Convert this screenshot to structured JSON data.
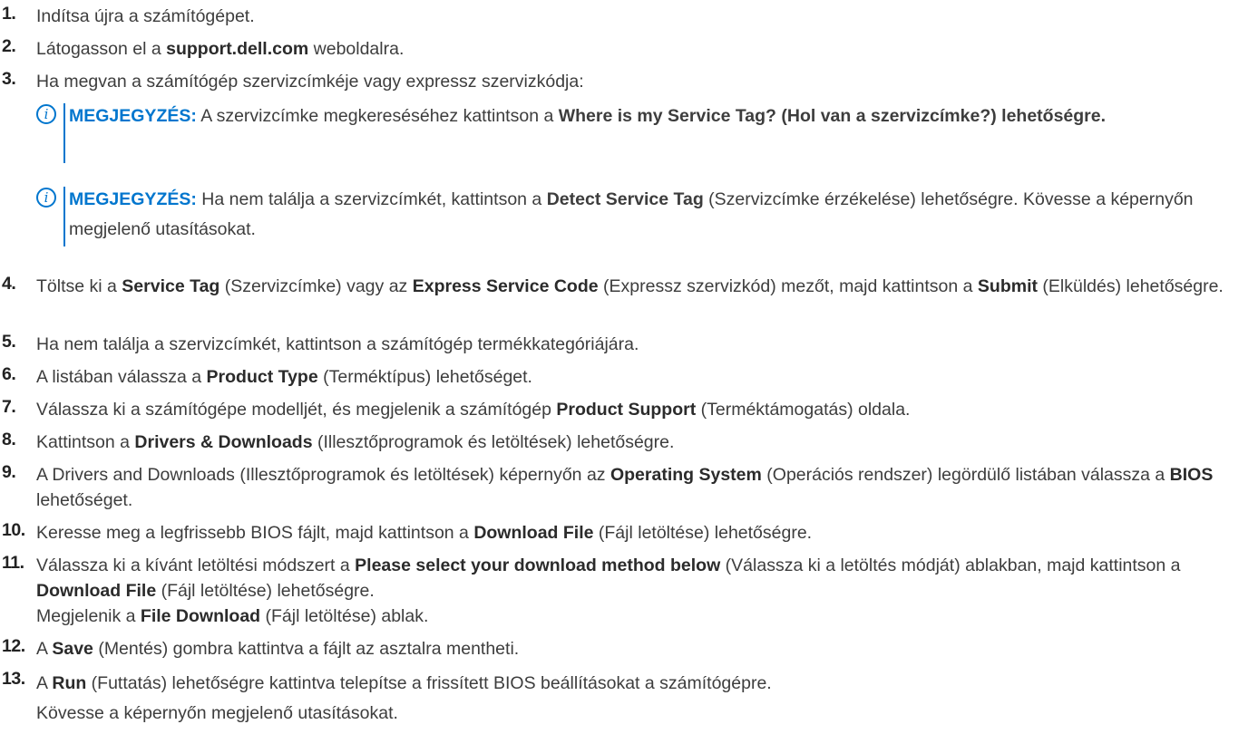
{
  "steps": [
    {
      "num": "1.",
      "text": [
        {
          "t": "Indítsa újra a számítógépet."
        }
      ]
    },
    {
      "num": "2.",
      "text": [
        {
          "t": "Látogasson el a "
        },
        {
          "t": "support.dell.com",
          "b": true
        },
        {
          "t": " weboldalra."
        }
      ]
    },
    {
      "num": "3.",
      "text": [
        {
          "t": "Ha megvan a számítógép szervizcímkéje vagy expressz szervizkódja:"
        }
      ]
    },
    {
      "num": "4.",
      "text": [
        {
          "t": "Töltse ki a "
        },
        {
          "t": "Service Tag",
          "b": true
        },
        {
          "t": " (Szervizcímke) vagy az "
        },
        {
          "t": "Express Service Code",
          "b": true
        },
        {
          "t": " (Expressz szervizkód) mezőt, majd kattintson a "
        },
        {
          "t": "Submit",
          "b": true
        },
        {
          "t": " (Elküldés) lehetőségre."
        }
      ]
    },
    {
      "num": "5.",
      "text": [
        {
          "t": "Ha nem találja a szervizcímkét, kattintson a számítógép termékkategóriájára."
        }
      ]
    },
    {
      "num": "6.",
      "text": [
        {
          "t": "A listában válassza a "
        },
        {
          "t": "Product Type",
          "b": true
        },
        {
          "t": " (Terméktípus) lehetőséget."
        }
      ]
    },
    {
      "num": "7.",
      "text": [
        {
          "t": "Válassza ki a számítógépe modelljét, és megjelenik a számítógép "
        },
        {
          "t": "Product Support",
          "b": true
        },
        {
          "t": " (Terméktámogatás) oldala."
        }
      ]
    },
    {
      "num": "8.",
      "text": [
        {
          "t": "Kattintson a "
        },
        {
          "t": "Drivers & Downloads",
          "b": true
        },
        {
          "t": " (Illesztőprogramok és letöltések) lehetőségre."
        }
      ]
    },
    {
      "num": "9.",
      "text": [
        {
          "t": "A Drivers and Downloads (Illesztőprogramok és letöltések) képernyőn az "
        },
        {
          "t": "Operating System",
          "b": true
        },
        {
          "t": " (Operációs rendszer) legördülő listában válassza a "
        },
        {
          "t": "BIOS",
          "b": true
        },
        {
          "t": " lehetőséget."
        }
      ]
    },
    {
      "num": "10.",
      "text": [
        {
          "t": "Keresse meg a legfrissebb BIOS fájlt, majd kattintson a "
        },
        {
          "t": "Download File",
          "b": true
        },
        {
          "t": " (Fájl letöltése) lehetőségre."
        }
      ]
    },
    {
      "num": "11.",
      "text": [
        {
          "t": "Válassza ki a kívánt letöltési módszert a "
        },
        {
          "t": "Please select your download method below",
          "b": true
        },
        {
          "t": " (Válassza ki a letöltés módját) ablakban, majd kattintson a "
        },
        {
          "t": "Download File",
          "b": true
        },
        {
          "t": " (Fájl letöltése) lehetőségre."
        }
      ],
      "extra": [
        {
          "t": "Megjelenik a "
        },
        {
          "t": "File Download",
          "b": true
        },
        {
          "t": " (Fájl letöltése) ablak."
        }
      ]
    },
    {
      "num": "12.",
      "text": [
        {
          "t": "A "
        },
        {
          "t": "Save",
          "b": true
        },
        {
          "t": " (Mentés) gombra kattintva a fájlt az asztalra mentheti."
        }
      ]
    },
    {
      "num": "13.",
      "text": [
        {
          "t": "A "
        },
        {
          "t": "Run",
          "b": true
        },
        {
          "t": " (Futtatás) lehetőségre kattintva telepítse a frissített BIOS beállításokat a számítógépre."
        }
      ],
      "extra": [
        {
          "t": "Kövesse a képernyőn megjelenő utasításokat."
        }
      ]
    }
  ],
  "notes": [
    {
      "label": "MEGJEGYZÉS:",
      "text": [
        {
          "t": " A szervizcímke megkereséséhez kattintson a "
        },
        {
          "t": "Where is my Service Tag? (Hol van a szervizcímke?) lehetőségre.",
          "b": true
        }
      ]
    },
    {
      "label": "MEGJEGYZÉS:",
      "text": [
        {
          "t": " Ha nem találja a szervizcímkét, kattintson a "
        },
        {
          "t": "Detect Service Tag",
          "b": true
        },
        {
          "t": " (Szervizcímke érzékelése) lehetőségre. Kövesse a képernyőn megjelenő utasításokat."
        }
      ]
    }
  ],
  "icons": {
    "note": "info-icon"
  },
  "colors": {
    "accent": "#0076ce",
    "text": "#3d3d3d"
  }
}
